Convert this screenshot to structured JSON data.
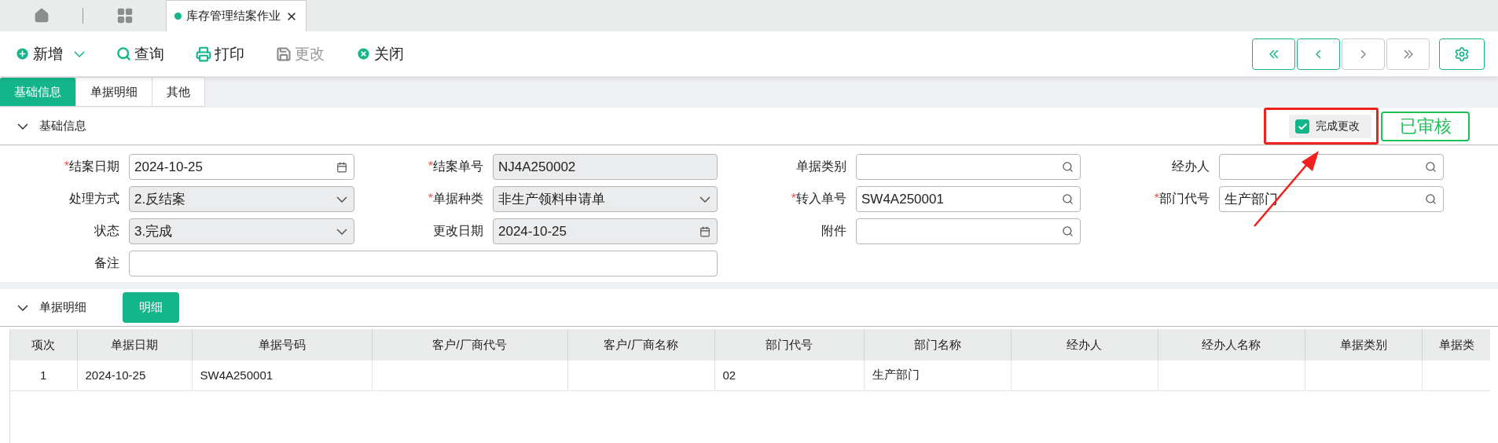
{
  "window_tabs": {
    "open_tab": {
      "title": "库存管理结案作业",
      "active": true
    }
  },
  "toolbar": {
    "buttons": [
      {
        "kind": "add",
        "label": "新增",
        "disabled": false,
        "dropdown": true
      },
      {
        "kind": "search",
        "label": "查询",
        "disabled": false
      },
      {
        "kind": "print",
        "label": "打印",
        "disabled": false
      },
      {
        "kind": "save",
        "label": "更改",
        "disabled": true
      },
      {
        "kind": "close",
        "label": "关闭",
        "disabled": false
      }
    ],
    "nav": [
      {
        "kind": "first",
        "disabled": false
      },
      {
        "kind": "prev",
        "disabled": false
      },
      {
        "kind": "next",
        "disabled": true
      },
      {
        "kind": "last",
        "disabled": true
      }
    ]
  },
  "section_tabs": [
    {
      "label": "基础信息",
      "selected": true
    },
    {
      "label": "单据明细",
      "selected": false
    },
    {
      "label": "其他",
      "selected": false
    }
  ],
  "basic_info": {
    "title": "基础信息",
    "expanded": true,
    "complete_change": {
      "label": "完成更改",
      "checked": true
    },
    "status_badge": "已审核",
    "rows": [
      [
        {
          "label": "结案日期",
          "required_mark": "*",
          "kind": "date",
          "readonly": false,
          "value": "2024-10-25"
        },
        {
          "label": "结案单号",
          "required_mark": "*",
          "kind": "text",
          "readonly": true,
          "value": "NJ4A250002"
        },
        {
          "label": "单据类别",
          "kind": "lookup",
          "readonly": false
        },
        {
          "label": "经办人",
          "kind": "lookup",
          "readonly": false
        }
      ],
      [
        {
          "label": "处理方式",
          "kind": "select",
          "readonly": true,
          "value": "2.反结案"
        },
        {
          "label": "单据种类",
          "required_mark": "*",
          "kind": "select",
          "readonly": true,
          "value": "非生产领料申请单"
        },
        {
          "label": "转入单号",
          "required_mark": "*",
          "kind": "lookup",
          "readonly": false,
          "value": "SW4A250001"
        },
        {
          "label": "部门代号",
          "required_mark": "*",
          "kind": "lookup",
          "readonly": false,
          "value": "生产部门"
        }
      ],
      [
        {
          "label": "状态",
          "kind": "select",
          "readonly": true,
          "value": "3.完成"
        },
        {
          "label": "更改日期",
          "kind": "date",
          "readonly": true,
          "value": "2024-10-25"
        },
        {
          "label": "附件",
          "kind": "lookup",
          "readonly": false
        }
      ],
      [
        {
          "label": "备注",
          "kind": "memo",
          "readonly": false
        }
      ]
    ]
  },
  "detail": {
    "title": "单据明细",
    "expanded": true,
    "button": "明细",
    "table": {
      "columns": [
        "项次",
        "单据日期",
        "单据号码",
        "客户/厂商代号",
        "客户/厂商名称",
        "部门代号",
        "部门名称",
        "经办人",
        "经办人名称",
        "单据类别",
        "单据类"
      ],
      "rows": [
        {
          "cells": [
            "1",
            "2024-10-25",
            "SW4A250001",
            null,
            null,
            "02",
            "生产部门",
            null,
            null,
            null,
            null
          ]
        }
      ]
    }
  }
}
